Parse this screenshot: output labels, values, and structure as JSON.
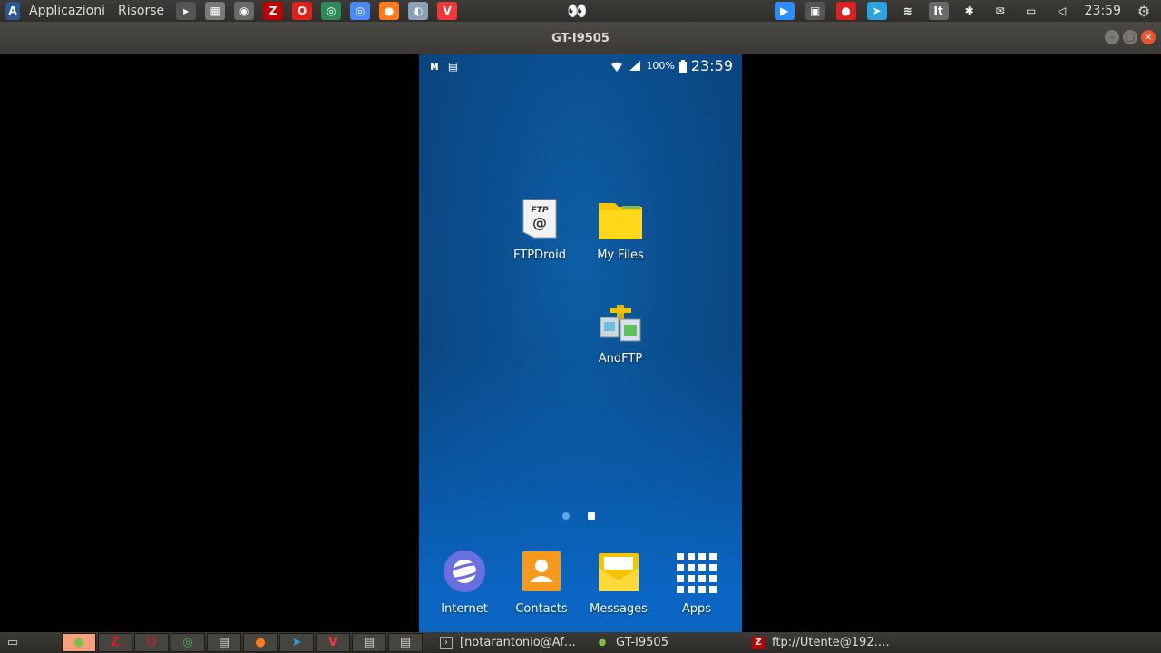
{
  "top_panel": {
    "menus": [
      {
        "label": "Applicazioni",
        "icon": "ubuntu-app-icon"
      },
      {
        "label": "Risorse"
      }
    ],
    "launchers": [
      {
        "name": "terminal-icon",
        "glyph": "▸",
        "color": "#555555"
      },
      {
        "name": "calculator-icon",
        "glyph": "▦",
        "color": "#7a7a7a"
      },
      {
        "name": "screenshot-icon",
        "glyph": "◉",
        "color": "#6a6a6a"
      },
      {
        "name": "filezilla-icon",
        "glyph": "Z",
        "color": "#bf0000"
      },
      {
        "name": "opera-icon",
        "glyph": "O",
        "color": "#e0201c"
      },
      {
        "name": "chrome-icon",
        "glyph": "◎",
        "color": "#2e8b57"
      },
      {
        "name": "chromium-icon",
        "glyph": "◎",
        "color": "#4a8af4"
      },
      {
        "name": "firefox-icon",
        "glyph": "●",
        "color": "#ff7a1a"
      },
      {
        "name": "globe-icon",
        "glyph": "◐",
        "color": "#8aa0b8"
      },
      {
        "name": "vivaldi-icon",
        "glyph": "V",
        "color": "#ef3939"
      }
    ],
    "center_glyph": "👀",
    "tray": [
      {
        "name": "zoom-icon",
        "glyph": "▶",
        "color": "#2d8cff"
      },
      {
        "name": "screen-share-icon",
        "glyph": "▣",
        "color": "#555555"
      },
      {
        "name": "record-icon",
        "glyph": "●",
        "color": "#e02020"
      },
      {
        "name": "telegram-icon",
        "glyph": "➤",
        "color": "#2aa3de"
      },
      {
        "name": "wifi-icon",
        "glyph": "≋",
        "color": "transparent"
      },
      {
        "name": "keyboard-layout-icon",
        "glyph": "It",
        "color": "#6a6a6a"
      },
      {
        "name": "bluetooth-icon",
        "glyph": "✱",
        "color": "transparent"
      },
      {
        "name": "mail-icon",
        "glyph": "✉",
        "color": "transparent"
      },
      {
        "name": "battery-icon",
        "glyph": "▭",
        "color": "transparent"
      },
      {
        "name": "volume-icon",
        "glyph": "◁",
        "color": "transparent"
      }
    ],
    "clock": "23:59"
  },
  "window": {
    "title": "GT-I9505"
  },
  "phone": {
    "status_bar": {
      "left_icons": [
        "ᴍ",
        "▤"
      ],
      "battery_percent": "100%",
      "time": "23:59"
    },
    "apps": [
      {
        "label": "FTPDroid"
      },
      {
        "label": "My Files"
      },
      {
        "label": "AndFTP"
      }
    ],
    "dock": [
      {
        "label": "Internet"
      },
      {
        "label": "Contacts"
      },
      {
        "label": "Messages"
      },
      {
        "label": "Apps"
      }
    ]
  },
  "taskbar": {
    "tasks": [
      {
        "label": "[notarantonio@Af…"
      },
      {
        "label": "GT-I9505"
      },
      {
        "label": "ftp://Utente@192.…"
      }
    ]
  }
}
